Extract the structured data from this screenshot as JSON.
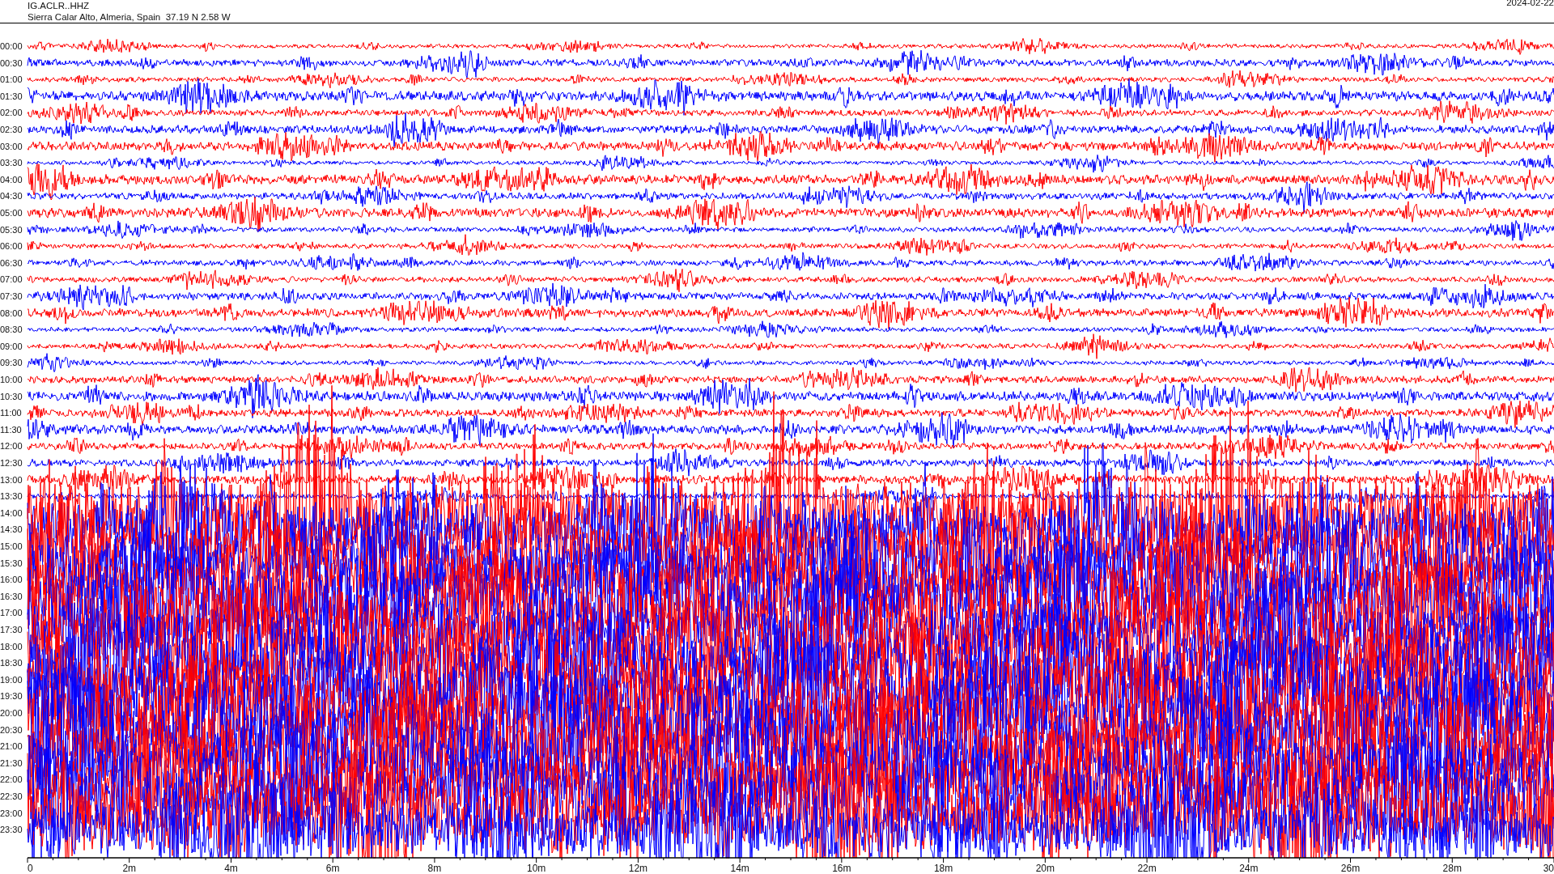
{
  "header": {
    "station": "IG.ACLR..HHZ",
    "location": "Sierra Calar Alto, Almeria, Spain  37.19 N 2.58 W",
    "date": "2024-02-22"
  },
  "helicorder": {
    "traces": [
      {
        "label": "00:00"
      },
      {
        "label": "00:30"
      },
      {
        "label": "01:00"
      },
      {
        "label": "01:30"
      },
      {
        "label": "02:00"
      },
      {
        "label": "02:30"
      },
      {
        "label": "03:00"
      },
      {
        "label": "03:30"
      },
      {
        "label": "04:00"
      },
      {
        "label": "04:30"
      },
      {
        "label": "05:00"
      },
      {
        "label": "05:30"
      },
      {
        "label": "06:00"
      },
      {
        "label": "06:30"
      },
      {
        "label": "07:00"
      },
      {
        "label": "07:30"
      },
      {
        "label": "08:00"
      },
      {
        "label": "08:30"
      },
      {
        "label": "09:00"
      },
      {
        "label": "09:30"
      },
      {
        "label": "10:00"
      },
      {
        "label": "10:30"
      },
      {
        "label": "11:00"
      },
      {
        "label": "11:30"
      },
      {
        "label": "12:00"
      },
      {
        "label": "12:30"
      },
      {
        "label": "13:00"
      },
      {
        "label": "13:30"
      },
      {
        "label": "14:00"
      },
      {
        "label": "14:30"
      },
      {
        "label": "15:00"
      },
      {
        "label": "15:30"
      },
      {
        "label": "16:00"
      },
      {
        "label": "16:30"
      },
      {
        "label": "17:00"
      },
      {
        "label": "17:30"
      },
      {
        "label": "18:00"
      },
      {
        "label": "18:30"
      },
      {
        "label": "19:00"
      },
      {
        "label": "19:30"
      },
      {
        "label": "20:00"
      },
      {
        "label": "20:30"
      },
      {
        "label": "21:00"
      },
      {
        "label": "21:30"
      },
      {
        "label": "22:00"
      },
      {
        "label": "22:30"
      },
      {
        "label": "23:00"
      },
      {
        "label": "23:30"
      }
    ],
    "x_ticks": [
      "0",
      "2m",
      "4m",
      "6m",
      "8m",
      "10m",
      "12m",
      "14m",
      "16m",
      "18m",
      "20m",
      "22m",
      "24m",
      "26m",
      "28m",
      "30"
    ]
  }
}
